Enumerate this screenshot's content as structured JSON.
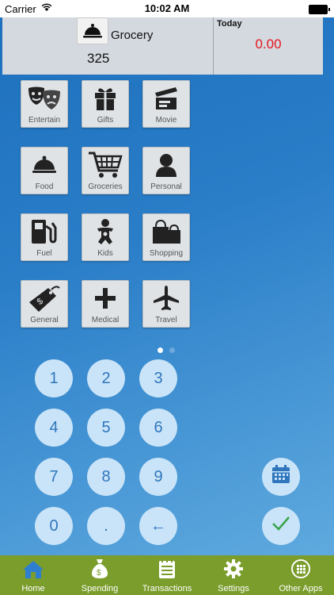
{
  "status": {
    "carrier": "Carrier",
    "time": "10:02 AM"
  },
  "header": {
    "category": "Grocery",
    "amount": "325"
  },
  "today": {
    "label": "Today",
    "value": "0.00"
  },
  "categories": [
    "Entertain",
    "Gifts",
    "Movie",
    "Food",
    "Groceries",
    "Personal",
    "Fuel",
    "Kids",
    "Shopping",
    "General",
    "Medical",
    "Travel"
  ],
  "keypad": [
    "1",
    "2",
    "3",
    "4",
    "5",
    "6",
    "7",
    "8",
    "9",
    "0",
    ".",
    "←"
  ],
  "tabs": [
    "Home",
    "Spending",
    "Transactions",
    "Settings",
    "Other Apps"
  ],
  "colors": {
    "accent": "#2f76bd",
    "today_value": "#e8141e",
    "tabbar": "#7a9d2c",
    "home_tab": "#2f7fd0"
  }
}
